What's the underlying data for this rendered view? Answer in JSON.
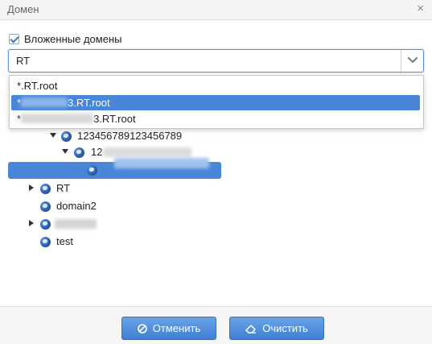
{
  "window": {
    "title": "Домен",
    "close_glyph": "×"
  },
  "checkbox": {
    "label": "Вложенные домены",
    "checked": true
  },
  "combo": {
    "value": "RT"
  },
  "dropdown": {
    "items": [
      {
        "prefix": "*",
        "text": ".RT.root",
        "selected": false
      },
      {
        "prefix": "*",
        "text": "3.RT.root",
        "selected": true
      },
      {
        "prefix": "*",
        "text": "3.RT.root",
        "selected": false
      }
    ]
  },
  "tree": {
    "nodes": [
      {
        "label": "123456789123456789",
        "expanded": true
      },
      {
        "label": "12",
        "expanded": true
      },
      {
        "label": "",
        "selected": true
      },
      {
        "label": "RT",
        "expanded": false
      },
      {
        "label": "domain2"
      },
      {
        "label": "",
        "expanded": false
      },
      {
        "label": "test"
      }
    ]
  },
  "footer": {
    "cancel_label": "Отменить",
    "clear_label": "Очистить"
  },
  "colors": {
    "accent": "#4a86d8",
    "button_top": "#6aa3e6",
    "button_bottom": "#3f7fd3"
  }
}
